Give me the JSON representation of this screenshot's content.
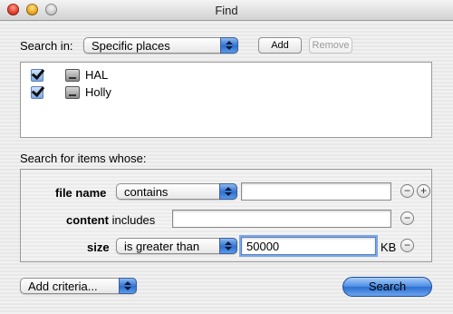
{
  "window": {
    "title": "Find"
  },
  "search_in": {
    "label": "Search in:",
    "selected": "Specific places",
    "add_label": "Add",
    "remove_label": "Remove"
  },
  "locations": [
    {
      "name": "HAL",
      "checked": true
    },
    {
      "name": "Holly",
      "checked": true
    }
  ],
  "criteria_header": "Search for items whose:",
  "criteria": {
    "file_name": {
      "label": "file name",
      "operator": "contains",
      "value": ""
    },
    "content": {
      "label_bold": "content",
      "label_rest": "includes",
      "value": ""
    },
    "size": {
      "label": "size",
      "operator": "is greater than",
      "value": "50000",
      "unit": "KB"
    }
  },
  "add_criteria_label": "Add criteria...",
  "search_button": "Search",
  "symbols": {
    "remove": "−",
    "add": "+"
  },
  "colors": {
    "accent": "#2d6fd0"
  }
}
